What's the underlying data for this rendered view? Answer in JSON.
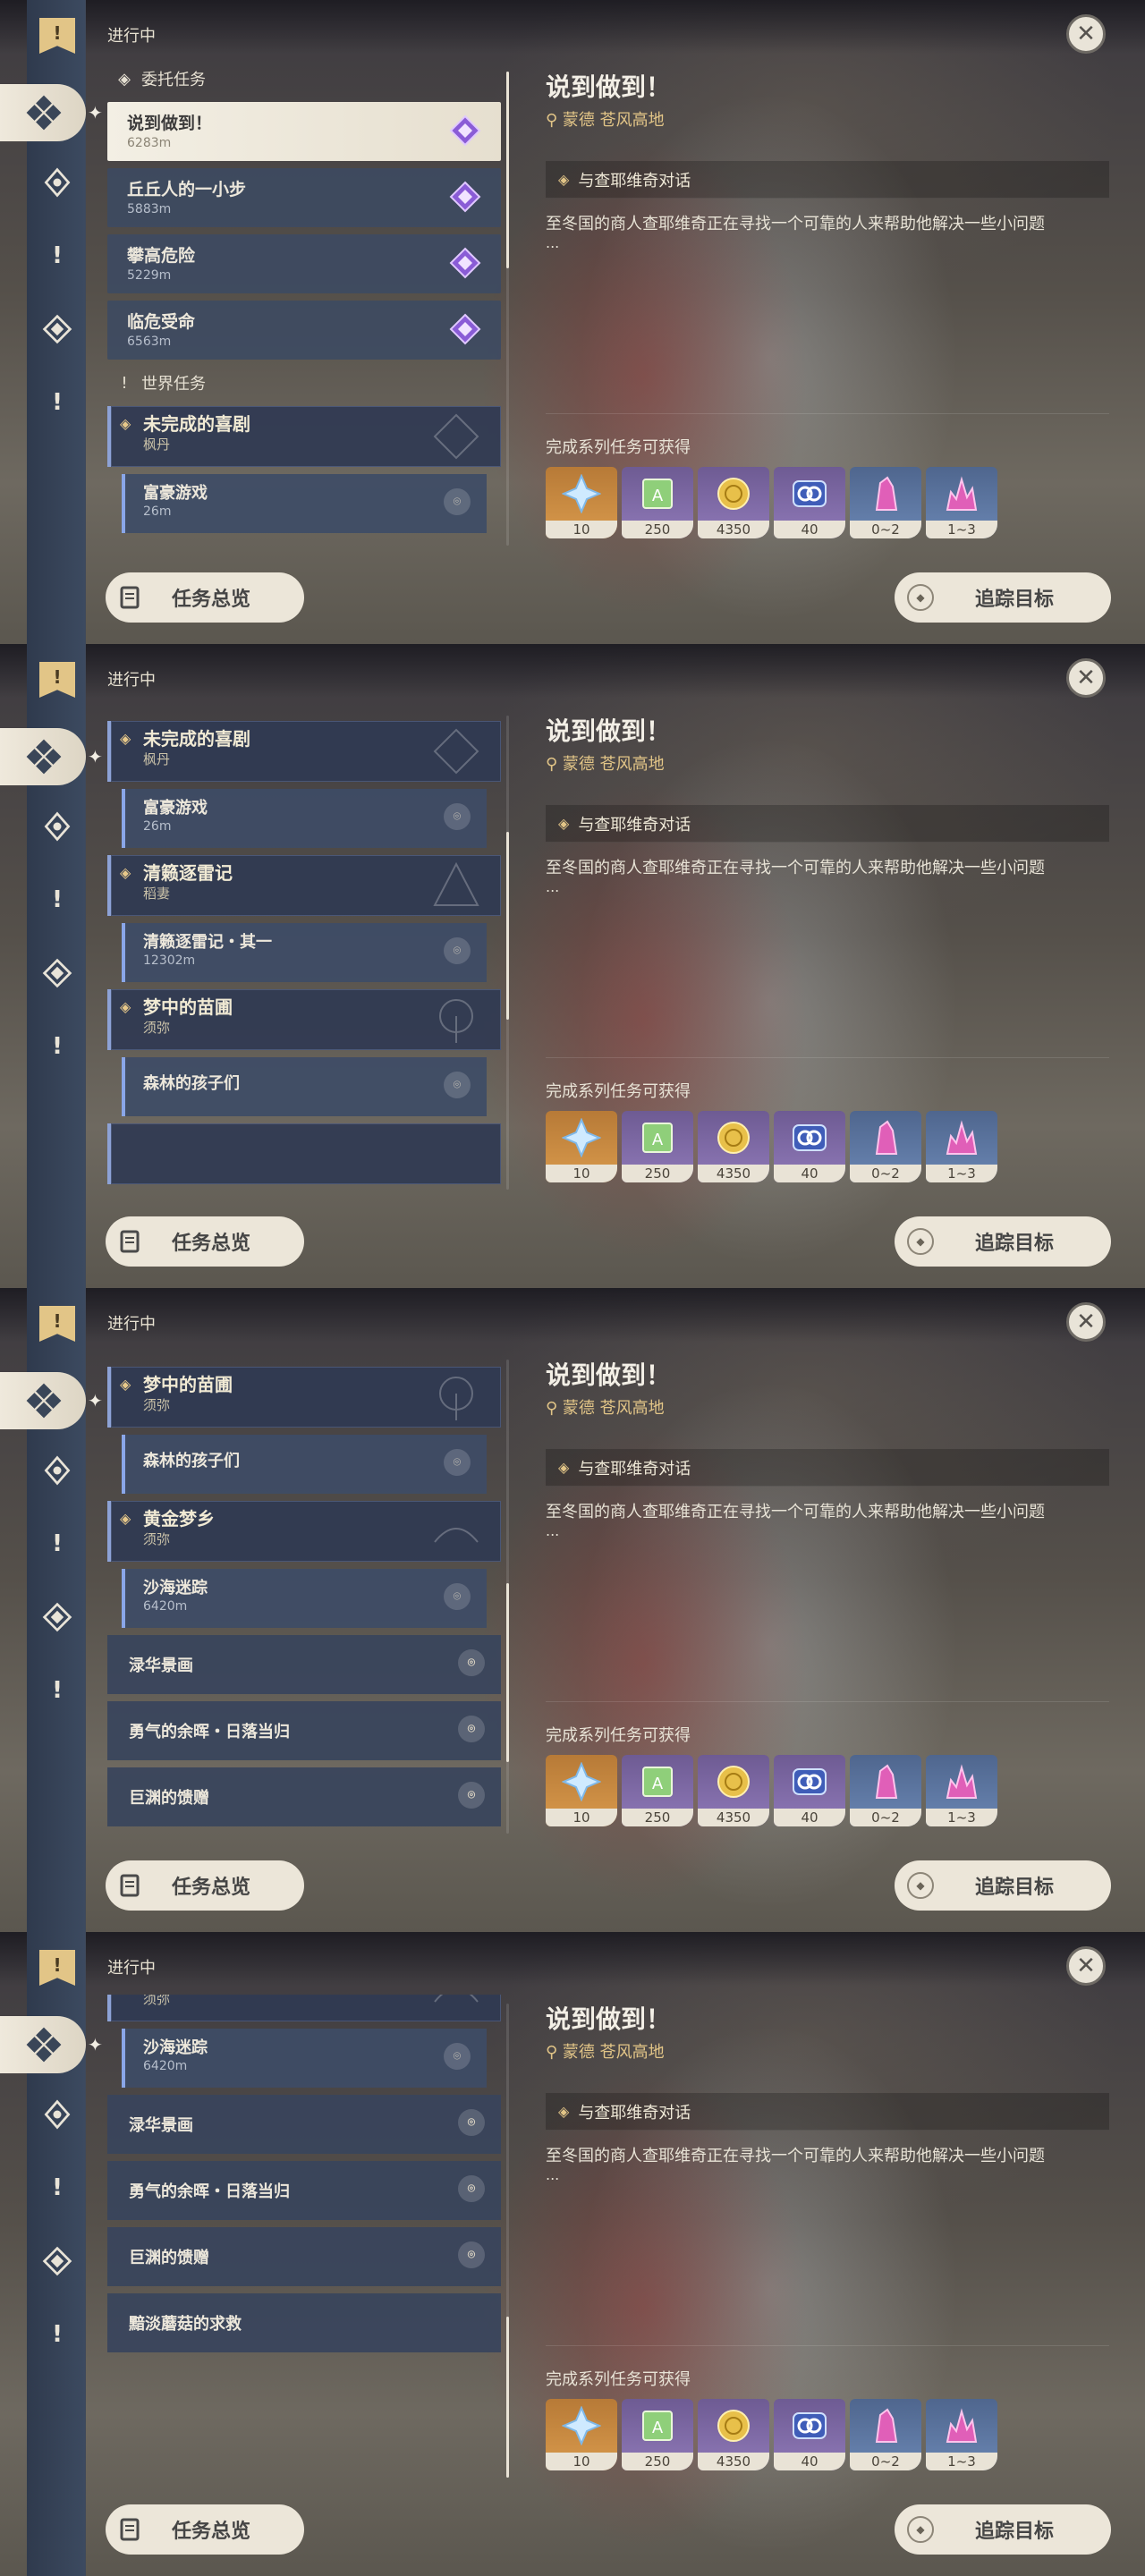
{
  "colors": {
    "accent_gold": "#e2c587",
    "rail": "#2f3a4d",
    "list_item": "#3c4a62",
    "button_bg": "#ece6d9"
  },
  "common": {
    "status_label": "进行中",
    "close_glyph": "✕",
    "overview_label": "任务总览",
    "track_label": "追踪目标",
    "rail_icons": [
      "bookmark-icon",
      "commission-icon",
      "archon-quest-icon",
      "world-quest-icon",
      "story-quest-icon",
      "world-quest-icon"
    ]
  },
  "detail": {
    "title": "说到做到！",
    "region": "蒙德 苍风高地",
    "objective": "与查耶维奇对话",
    "description": "至冬国的商人查耶维奇正在寻找一个可靠的人来帮助他解决一些小问题",
    "ellipsis": "...",
    "reward_label": "完成系列任务可获得",
    "rewards": [
      {
        "icon": "primogem-icon",
        "count": "10"
      },
      {
        "icon": "adventure-exp-icon",
        "count": "250"
      },
      {
        "icon": "mora-icon",
        "count": "4350"
      },
      {
        "icon": "companionship-exp-icon",
        "count": "40"
      },
      {
        "icon": "crystal-chunk-icon",
        "count": "0~2"
      },
      {
        "icon": "crystal-cluster-icon",
        "count": "1~3"
      }
    ]
  },
  "quests": {
    "commission_header": "委托任务",
    "commissions": [
      {
        "title": "说到做到！",
        "dist": "6283m"
      },
      {
        "title": "丘丘人的一小步",
        "dist": "5883m"
      },
      {
        "title": "攀高危险",
        "dist": "5229m"
      },
      {
        "title": "临危受命",
        "dist": "6563m"
      }
    ],
    "world_header": "世界任务",
    "world": [
      {
        "series": "未完成的喜剧",
        "region": "枫丹",
        "sub": "富豪游戏",
        "sub_dist": "26m"
      },
      {
        "series": "清籁逐雷记",
        "region": "稻妻",
        "sub": "清籁逐雷记・其一",
        "sub_dist": "12302m"
      },
      {
        "series": "梦中的苗圃",
        "region": "须弥",
        "sub": "森林的孩子们",
        "sub_dist": ""
      },
      {
        "series": "黄金梦乡",
        "region": "须弥",
        "sub": "沙海迷踪",
        "sub_dist": "6420m"
      }
    ],
    "plain": [
      "渌华景画",
      "勇气的余晖・日落当归",
      "巨渊的馈赠",
      "黯淡蘑菇的求救"
    ]
  }
}
